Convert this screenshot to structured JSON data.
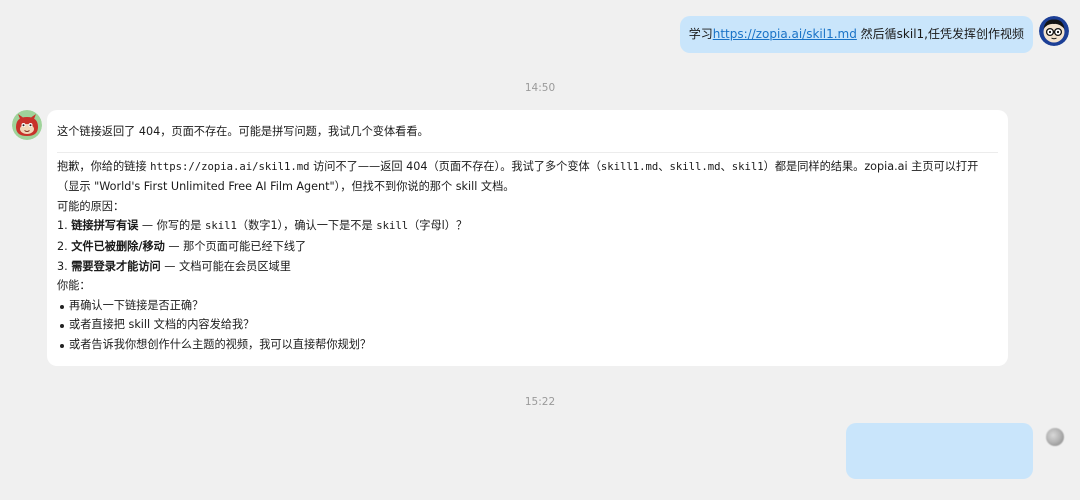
{
  "messages": {
    "user_first": {
      "prefix": "学习",
      "link": "https://zopia.ai/skil1.md",
      "suffix": " 然后循skil1,任凭发挥创作视频"
    },
    "time_first": "14:50",
    "bot": {
      "intro": "这个链接返回了 404，页面不存在。可能是拼写问题，我试几个变体看看。",
      "p1_a": "抱歉，你给的链接 ",
      "p1_url": "https://zopia.ai/skil1.md",
      "p1_b": " 访问不了——返回 404（页面不存在）。我试了多个变体（",
      "p1_v1": "skill1.md",
      "p1_c": "、",
      "p1_v2": "skill.md",
      "p1_d": "、",
      "p1_v3": "skil1",
      "p1_e": "）都是同样的结果。zopia.ai 主页可以打开（显示 \"World's First Unlimited Free AI Film Agent\"），但找不到你说的那个 skill 文档。",
      "reasons_title": "可能的原因：",
      "r1_num": "1. ",
      "r1_bold": "链接拼写有误",
      "r1_a": " — 你写的是 ",
      "r1_code1": "skil1",
      "r1_b": "（数字1），确认一下是不是 ",
      "r1_code2": "skill",
      "r1_c": "（字母l）？",
      "r2_num": "2. ",
      "r2_bold": "文件已被删除/移动",
      "r2_text": " — 那个页面可能已经下线了",
      "r3_num": "3. ",
      "r3_bold": "需要登录才能访问",
      "r3_text": " — 文档可能在会员区域里",
      "you_can": "你能：",
      "bullets": [
        "再确认一下链接是否正确？",
        "或者直接把 skill 文档的内容发给我？",
        "或者告诉我你想创作什么主题的视频，我可以直接帮你规划？"
      ]
    },
    "time_second": "15:22"
  },
  "colors": {
    "background": "#f0f0f0",
    "user_bubble": "#c9e5fb",
    "bot_bubble": "#ffffff",
    "link": "#1a73c7"
  }
}
